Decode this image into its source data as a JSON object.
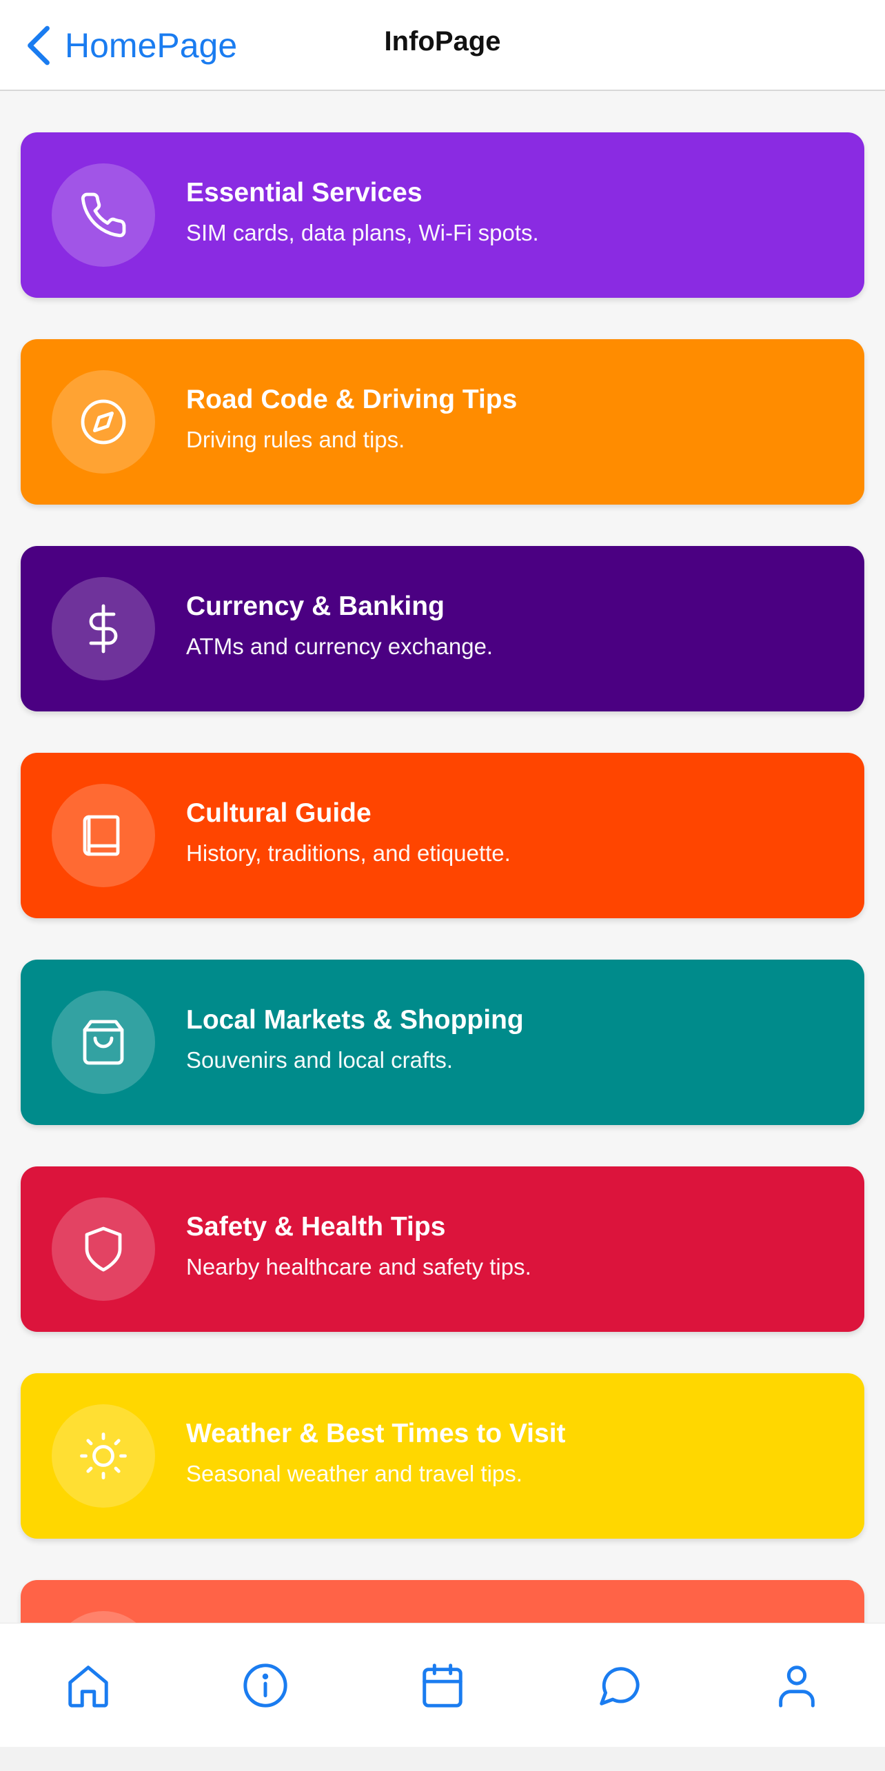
{
  "header": {
    "back_label": "HomePage",
    "title": "InfoPage"
  },
  "cards": [
    {
      "title": "Essential Services",
      "subtitle": "SIM cards, data plans, Wi-Fi spots.",
      "color": "#8a2be2",
      "icon": "phone-icon"
    },
    {
      "title": "Road Code & Driving Tips",
      "subtitle": "Driving rules and tips.",
      "color": "#ff8c00",
      "icon": "compass-icon"
    },
    {
      "title": "Currency & Banking",
      "subtitle": "ATMs and currency exchange.",
      "color": "#4b0082",
      "icon": "dollar-icon"
    },
    {
      "title": "Cultural Guide",
      "subtitle": "History, traditions, and etiquette.",
      "color": "#ff4500",
      "icon": "book-icon"
    },
    {
      "title": "Local Markets & Shopping",
      "subtitle": "Souvenirs and local crafts.",
      "color": "#008b8b",
      "icon": "shopping-bag-icon"
    },
    {
      "title": "Safety & Health Tips",
      "subtitle": "Nearby healthcare and safety tips.",
      "color": "#dc143c",
      "icon": "shield-icon"
    },
    {
      "title": "Weather & Best Times to Visit",
      "subtitle": "Seasonal weather and travel tips.",
      "color": "#ffd700",
      "icon": "sun-icon"
    },
    {
      "title": "",
      "subtitle": "",
      "color": "#ff6347",
      "icon": ""
    }
  ],
  "tabbar": {
    "accent": "#1a7cf0",
    "tabs": [
      "home-icon",
      "info-icon",
      "calendar-icon",
      "chat-icon",
      "user-icon"
    ]
  }
}
